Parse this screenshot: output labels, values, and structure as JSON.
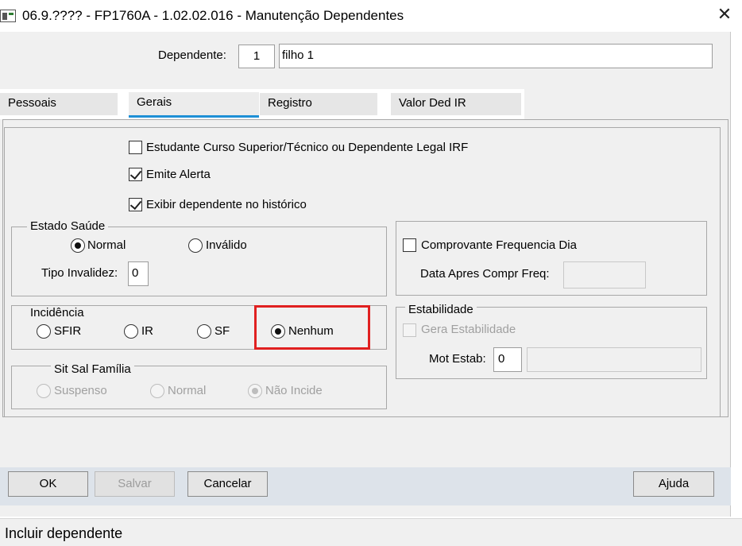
{
  "window": {
    "title": "06.9.???? - FP1760A - 1.02.02.016 - Manutenção Dependentes",
    "close_symbol": "✕"
  },
  "dependente": {
    "label": "Dependente:",
    "number": "1",
    "name": "filho 1"
  },
  "tabs": [
    {
      "label": "Pessoais",
      "active": false
    },
    {
      "label": "Gerais",
      "active": true
    },
    {
      "label": "Registro",
      "active": false
    },
    {
      "label": "Valor Ded IR",
      "active": false
    }
  ],
  "checkboxes": {
    "estudante": {
      "label": "Estudante Curso Superior/Técnico ou Dependente Legal IRF",
      "checked": false
    },
    "emite_alerta": {
      "label": "Emite Alerta",
      "checked": true
    },
    "exibir_historico": {
      "label": "Exibir dependente no histórico",
      "checked": true
    }
  },
  "estado_saude": {
    "title": "Estado Saúde",
    "options": [
      {
        "label": "Normal",
        "checked": true
      },
      {
        "label": "Inválido",
        "checked": false
      }
    ],
    "tipo_invalidez_label": "Tipo Invalidez:",
    "tipo_invalidez_value": "0"
  },
  "comprovante": {
    "checkbox_label": "Comprovante Frequencia Dia",
    "checked": false,
    "data_label": "Data Apres Compr Freq:",
    "data_value": ""
  },
  "incidencia": {
    "title": "Incidência",
    "options": [
      {
        "label": "SFIR",
        "checked": false
      },
      {
        "label": "IR",
        "checked": false
      },
      {
        "label": "SF",
        "checked": false
      },
      {
        "label": "Nenhum",
        "checked": true
      }
    ]
  },
  "estabilidade": {
    "title": "Estabilidade",
    "gera_label": "Gera Estabilidade",
    "mot_label": "Mot Estab:",
    "mot_code": "0",
    "mot_desc": ""
  },
  "sit_sal_familia": {
    "title": "Sit Sal Família",
    "options": [
      {
        "label": "Suspenso",
        "checked": false
      },
      {
        "label": "Normal",
        "checked": false
      },
      {
        "label": "Não Incide",
        "checked": true
      }
    ]
  },
  "buttons": {
    "ok": "OK",
    "salvar": "Salvar",
    "cancelar": "Cancelar",
    "ajuda": "Ajuda"
  },
  "status": "Incluir dependente",
  "colors": {
    "highlight": "#e02020",
    "active_tab_underline": "#1e90d6",
    "button_bar": "#dde3ea"
  }
}
